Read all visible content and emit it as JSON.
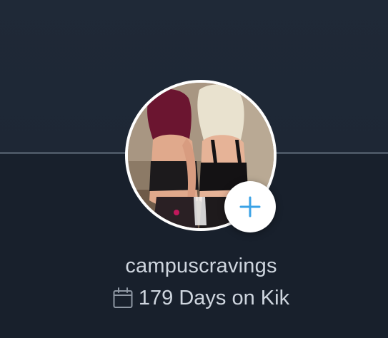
{
  "profile": {
    "username": "campuscravings",
    "days_on_kik": "179 Days on Kik"
  },
  "icons": {
    "add": "plus-icon",
    "calendar": "calendar-icon"
  },
  "colors": {
    "background": "#1b2431",
    "accent": "#3aa2e6",
    "text": "#cfd6df"
  }
}
